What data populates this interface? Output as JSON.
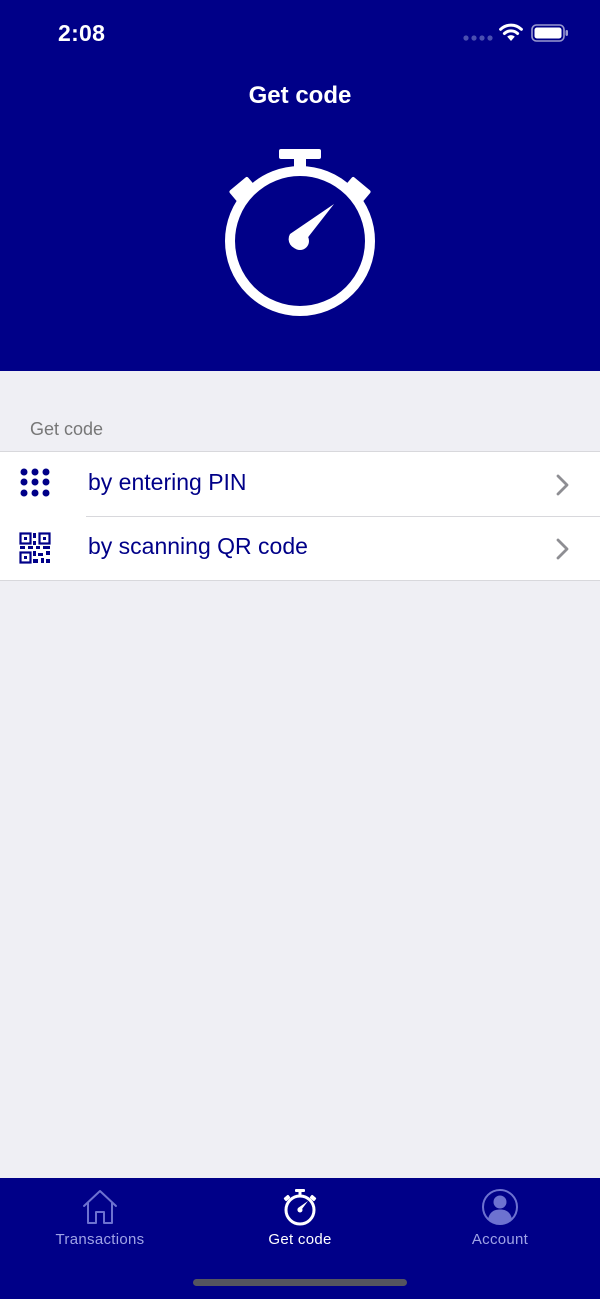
{
  "status_bar": {
    "time": "2:08"
  },
  "header": {
    "title": "Get code",
    "hero_icon": "stopwatch-icon"
  },
  "section": {
    "title": "Get code",
    "items": [
      {
        "label": "by entering PIN",
        "icon": "keypad-icon"
      },
      {
        "label": "by scanning QR code",
        "icon": "qr-code-icon"
      }
    ]
  },
  "tab_bar": {
    "tabs": [
      {
        "label": "Transactions",
        "icon": "home-icon",
        "active": false
      },
      {
        "label": "Get code",
        "icon": "stopwatch-icon",
        "active": true
      },
      {
        "label": "Account",
        "icon": "account-icon",
        "active": false
      }
    ]
  },
  "colors": {
    "brand": "#000088",
    "background": "#efeff4",
    "row_text": "#000088",
    "tab_inactive": "#9fa3e6",
    "tab_active": "#ffffff"
  }
}
